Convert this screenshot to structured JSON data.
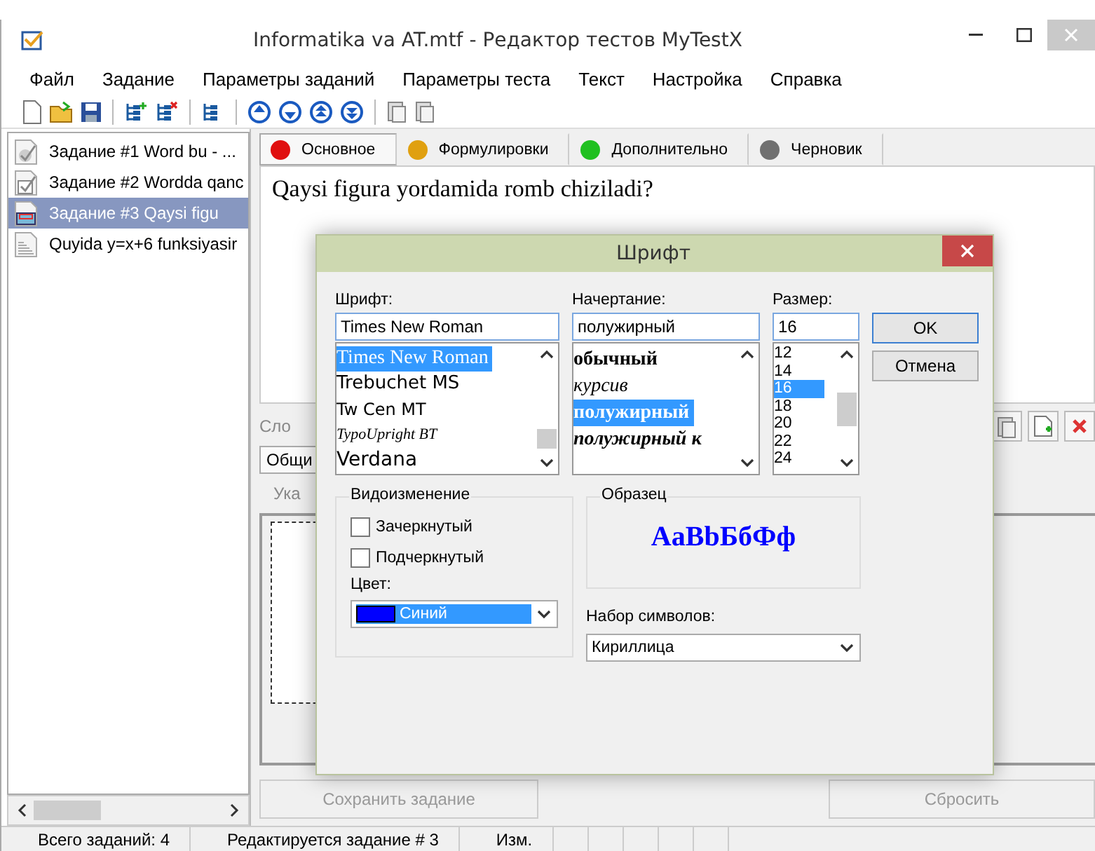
{
  "window": {
    "title": "Informatika va AT.mtf - Редактор тестов MyTestX"
  },
  "menu": [
    {
      "label": "Файл"
    },
    {
      "label": "Задание"
    },
    {
      "label": "Параметры заданий"
    },
    {
      "label": "Параметры теста"
    },
    {
      "label": "Текст"
    },
    {
      "label": "Настройка"
    },
    {
      "label": "Справка"
    }
  ],
  "task_list": [
    {
      "label": "Задание #1 Word bu - ...",
      "kind": "single",
      "selected": false
    },
    {
      "label": "Задание #2 Wordda qanc",
      "kind": "multiple",
      "selected": false
    },
    {
      "label": "Задание #3 Qaysi figu",
      "kind": "area",
      "selected": true
    },
    {
      "label": "Quyida y=x+6 funksiyasir",
      "kind": "ordering",
      "selected": false
    }
  ],
  "tabs": [
    {
      "label": "Основное",
      "color": "#e01010",
      "selected": true
    },
    {
      "label": "Формулировки",
      "color": "#e0a010",
      "selected": false
    },
    {
      "label": "Дополнительно",
      "color": "#20c020",
      "selected": false
    },
    {
      "label": "Черновик",
      "color": "#707070",
      "selected": false
    }
  ],
  "question": "Qaysi figura yordamida romb chiziladi?",
  "behind": {
    "difficulty_label": "Сло",
    "inner_tab": "Общи",
    "hint_label": "Ука"
  },
  "buttons": [
    {
      "label": "Сохранить задание",
      "disabled": true
    },
    {
      "label": "Сбросить",
      "disabled": true
    }
  ],
  "status_bar": [
    "Всего заданий: 4",
    "Редактируется задание # 3",
    "Изм."
  ],
  "font_dialog": {
    "title": "Шрифт",
    "font": {
      "label": "Шрифт:",
      "value": "Times New Roman",
      "options": [
        {
          "label": "Times New Roman",
          "selected": true
        },
        {
          "label": "Trebuchet MS",
          "selected": false
        },
        {
          "label": "Tw Cen MT",
          "selected": false
        },
        {
          "label": "TypoUpright BT",
          "selected": false
        },
        {
          "label": "Verdana",
          "selected": false
        }
      ]
    },
    "style": {
      "label": "Начертание:",
      "value": "полужирный",
      "options": [
        {
          "label": "обычный",
          "selected": false
        },
        {
          "label": "курсив",
          "selected": false
        },
        {
          "label": "полужирный",
          "selected": true
        },
        {
          "label": "полужирный к",
          "selected": false
        }
      ]
    },
    "size": {
      "label": "Размер:",
      "value": "16",
      "options": [
        {
          "label": "12",
          "selected": false
        },
        {
          "label": "14",
          "selected": false
        },
        {
          "label": "16",
          "selected": true
        },
        {
          "label": "18",
          "selected": false
        },
        {
          "label": "20",
          "selected": false
        },
        {
          "label": "22",
          "selected": false
        },
        {
          "label": "24",
          "selected": false
        }
      ]
    },
    "ok": "OK",
    "cancel": "Отмена",
    "effects": {
      "label": "Видоизменение",
      "options": [
        {
          "label": "Зачеркнутый",
          "checked": false
        },
        {
          "label": "Подчеркнутый",
          "checked": false
        }
      ]
    },
    "color": {
      "label": "Цвет:",
      "value": "Синий",
      "color": "#0000ff"
    },
    "sample": {
      "label": "Образец",
      "text": "AaBbБбФф"
    },
    "charset": {
      "label": "Набор символов:",
      "value": "Кириллица"
    }
  }
}
